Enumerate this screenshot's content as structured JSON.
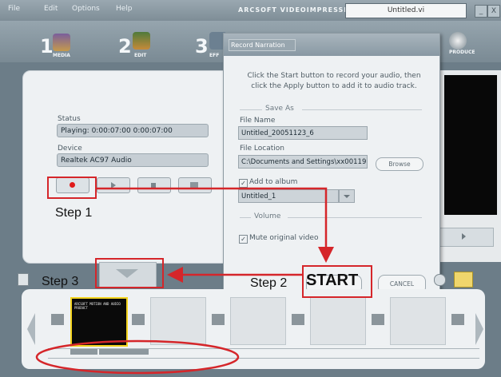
{
  "menu": [
    "File",
    "Edit",
    "Options",
    "Help"
  ],
  "app_title": "ARCSOFT VIDEOIMPRESSION",
  "document_name": "Untitled.vi",
  "window_controls": {
    "minimize": "_",
    "close": "X"
  },
  "steps": [
    {
      "num": "1",
      "label": "MEDIA"
    },
    {
      "num": "2",
      "label": "EDIT"
    },
    {
      "num": "3",
      "label": "EFF"
    }
  ],
  "produce_label": "PRODUCE",
  "left_panel": {
    "status_label": "Status",
    "status_value": "Playing:   0:00:07:00  0:00:07:00",
    "device_label": "Device",
    "device_value": "Realtek AC97 Audio"
  },
  "dialog": {
    "title": "Record Narration",
    "instructions": "Click the Start button to record your audio, then click the Apply button to add it to audio track.",
    "save_as_label": "Save As",
    "file_name_label": "File Name",
    "file_name_value": "Untitled_20051123_6",
    "file_location_label": "File Location",
    "file_location_value": "C:\\Documents and Settings\\xx00119",
    "browse_label": "Browse",
    "add_to_album_label": "Add to album",
    "album_value": "Untitled_1",
    "volume_label": "Volume",
    "mute_label": "Mute original video",
    "start_label": "START",
    "cancel_label": "CANCEL"
  },
  "annotations": {
    "step1": "Step 1",
    "step2": "Step 2",
    "step3": "Step 3"
  },
  "thumb_caption": "ARCSOFT MOTION AND AUDIO PRODUCT",
  "colors": {
    "annotation_red": "#d5262a",
    "record_red": "#e01b1b",
    "selection_yellow": "#f3d31d"
  }
}
